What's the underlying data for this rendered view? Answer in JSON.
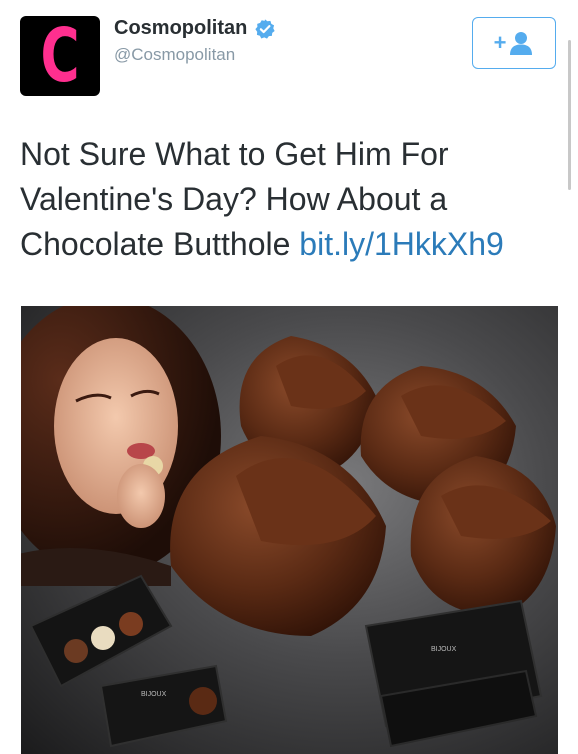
{
  "account": {
    "avatar_letter": "C",
    "name": "Cosmopolitan",
    "handle": "@Cosmopolitan",
    "verified_icon": "verified-badge-icon",
    "follow_icon": "add-user-icon",
    "follow_glyph": "+"
  },
  "tweet": {
    "text": "Not Sure What to Get Him For Valentine's Day? How About a Chocolate Butthole",
    "link": "bit.ly/1HkkXh9"
  },
  "photo": {
    "box_brand": "BIJOUX"
  },
  "colors": {
    "accent": "#55acee",
    "link": "#2b7bb9",
    "avatar_letter": "#ff2f8f",
    "text": "#292f33",
    "secondary": "#8899a6"
  }
}
